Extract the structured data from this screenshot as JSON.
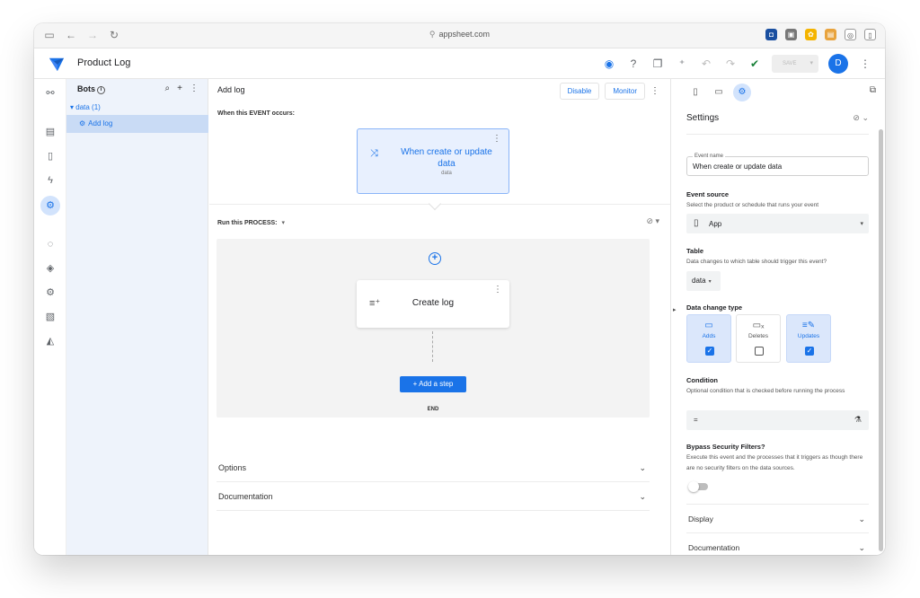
{
  "browser": {
    "url": "appsheet.com"
  },
  "app": {
    "title": "Product Log",
    "save_label": "SAVE",
    "avatar_initial": "D"
  },
  "bots_panel": {
    "title": "Bots",
    "tree_group": "data (1)",
    "tree_item": "Add log"
  },
  "editor": {
    "title": "Add log",
    "disable_label": "Disable",
    "monitor_label": "Monitor",
    "event_label": "When this EVENT occurs:",
    "event_card": {
      "title": "When create or update data",
      "subtitle": "data"
    },
    "process_label": "Run this PROCESS:",
    "step_title": "Create log",
    "add_step_label": "Add a step",
    "end_label": "END",
    "sections": [
      "Options",
      "Documentation"
    ]
  },
  "settings": {
    "title": "Settings",
    "event_name_label": "Event name",
    "event_name_value": "When create or update data",
    "event_source": {
      "label": "Event source",
      "help": "Select the product or schedule that runs your event",
      "value": "App"
    },
    "table": {
      "label": "Table",
      "help": "Data changes to which table should trigger this event?",
      "value": "data"
    },
    "data_change_type": {
      "label": "Data change type",
      "options": [
        {
          "label": "Adds",
          "checked": true
        },
        {
          "label": "Deletes",
          "checked": false
        },
        {
          "label": "Updates",
          "checked": true
        }
      ]
    },
    "condition": {
      "label": "Condition",
      "help": "Optional condition that is checked before running the process",
      "value": "="
    },
    "bypass": {
      "label": "Bypass Security Filters?",
      "help": "Execute this event and the processes that it triggers as though there are no security filters on the data sources.",
      "enabled": false
    },
    "sections": [
      "Display",
      "Documentation"
    ]
  },
  "colors": {
    "accent": "#1a73e8",
    "selected_bg": "#c9dbf5",
    "event_card_bg": "#e8f0fe"
  }
}
